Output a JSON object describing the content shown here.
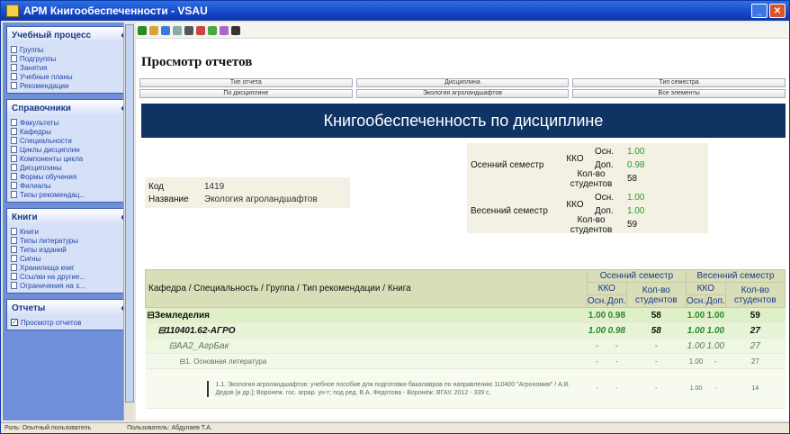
{
  "window": {
    "title": "АРМ Книгообеспеченности - VSAU"
  },
  "sidebar": {
    "panels": [
      {
        "title": "Учебный процесс",
        "items": [
          "Группы",
          "Подгруппы",
          "Занятия",
          "Учебные планы",
          "Рекомендации"
        ]
      },
      {
        "title": "Справочники",
        "items": [
          "Факультеты",
          "Кафедры",
          "Специальности",
          "Циклы дисциплин",
          "Компоненты цикла",
          "Дисциплины",
          "Формы обучения",
          "Филиалы",
          "Типы рекомендац..."
        ]
      },
      {
        "title": "Книги",
        "items": [
          "Книги",
          "Типы литературы",
          "Типы изданий",
          "Сигны",
          "Хранилища книг",
          "Ссылки на другие...",
          "Ограничения на з..."
        ]
      },
      {
        "title": "Отчеты",
        "items": [
          "Просмотр отчетов"
        ]
      }
    ]
  },
  "main": {
    "page_title": "Просмотр отчетов",
    "tabs": [
      "Тип отчета",
      "Дисциплина",
      "Тип семестра",
      "По дисциплине",
      "Экология агроландшафтов",
      "Все элементы"
    ],
    "banner": "Книгообеспеченность по дисциплине",
    "kod_label": "Код",
    "kod_value": "1419",
    "name_label": "Название",
    "name_value": "Экология агроландшафтов",
    "semesters": [
      {
        "name": "Осенний семестр",
        "kko": "ККО",
        "osn_label": "Осн.",
        "osn": "1.00",
        "dop_label": "Доп.",
        "dop": "0.98",
        "students_label": "Кол-во студентов",
        "students": "58"
      },
      {
        "name": "Весенний семестр",
        "kko": "ККО",
        "osn_label": "Осн.",
        "osn": "1.00",
        "dop_label": "Доп.",
        "dop": "1.00",
        "students_label": "Кол-во студентов",
        "students": "59"
      }
    ],
    "table": {
      "header_main": "Кафедра / Специальность / Группа / Тип рекомендации / Книга",
      "sem1": "Осенний семестр",
      "sem2": "Весенний семестр",
      "kko": "ККО",
      "osn": "Осн.",
      "dop": "Доп.",
      "students": "Кол-во студентов",
      "rows": [
        {
          "name": "⊟Земледелия",
          "a1": "1.00",
          "a2": "0.98",
          "a3": "58",
          "b1": "1.00",
          "b2": "1.00",
          "b3": "59"
        },
        {
          "name": "⊟110401.62-АГРО",
          "a1": "1.00",
          "a2": "0.98",
          "a3": "58",
          "b1": "1.00",
          "b2": "1.00",
          "b3": "27"
        },
        {
          "name": "⊟АА2_АгрБак",
          "a1": "-",
          "a2": "-",
          "a3": "-",
          "b1": "1.00",
          "b2": "1.00",
          "b3": "27"
        },
        {
          "name": "⊟1. Основная литература",
          "a1": "-",
          "a2": "-",
          "a3": "-",
          "b1": "1.00",
          "b2": "-",
          "b3": "27"
        },
        {
          "name": "1.1. Экология агроландшафтов: учебное пособие для подготовки бакалавров по направлению 110400 \"Агрономия\" / А.В. Дедов [и др.]; Воронеж. гос. аграр. ун-т; под ред. В.А. Федотова - Воронеж: ВГАУ, 2012 - 339 с.",
          "a1": "-",
          "a2": "-",
          "a3": "-",
          "b1": "1.00",
          "b2": "-",
          "b3": "14"
        }
      ]
    }
  },
  "status": {
    "role": "Роль: Опытный пользователь",
    "user": "Пользователь: Абдулаев Т.А."
  }
}
